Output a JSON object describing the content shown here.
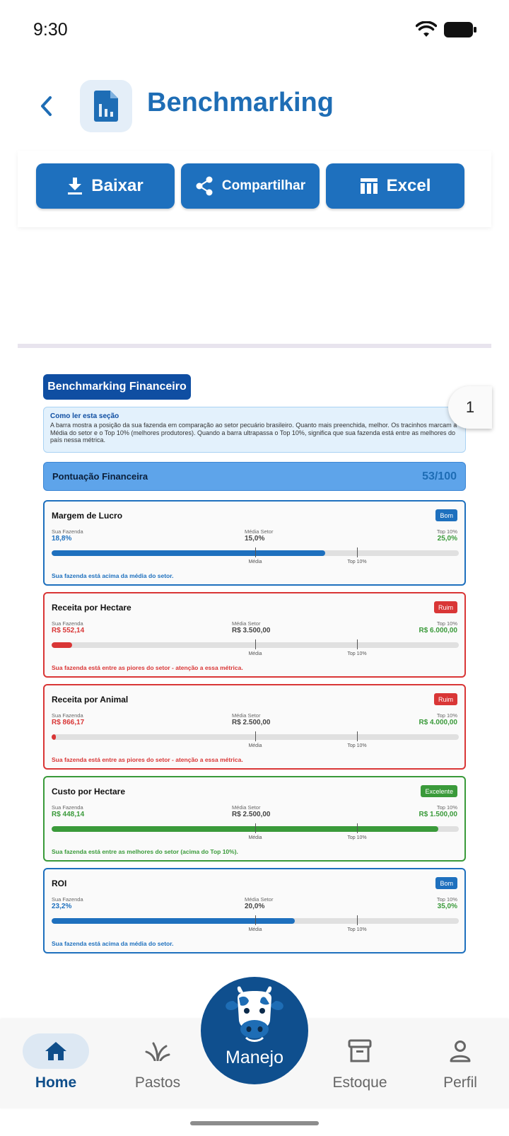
{
  "status_bar": {
    "time": "9:30"
  },
  "header": {
    "title": "Benchmarking"
  },
  "toolbar": {
    "download_label": "Baixar",
    "share_label": "Compartilhar",
    "excel_label": "Excel"
  },
  "page_indicator": "1",
  "section": {
    "title": "Benchmarking Financeiro",
    "info_title": "Como ler esta seção",
    "info_text": "A barra mostra a posição da sua fazenda em comparação ao setor pecuário brasileiro. Quanto mais preenchida, melhor. Os tracinhos marcam a Média do setor e o Top 10% (melhores produtores). Quando a barra ultrapassa o Top 10%, significa que sua fazenda está entre as melhores do país nessa métrica.",
    "score_label": "Pontuação Financeira",
    "score_value": "53/100"
  },
  "labels": {
    "farm": "Sua Fazenda",
    "sector_avg": "Média Setor",
    "top10": "Top 10%",
    "avg_tick": "Média",
    "top_tick": "Top 10%"
  },
  "metrics": [
    {
      "name": "Margem de Lucro",
      "badge": "Bom",
      "farm": "18,8%",
      "avg": "15,0%",
      "top": "25,0%",
      "fill_fraction": 0.672,
      "message": "Sua fazenda está acima da média do setor.",
      "color": "#1e70be"
    },
    {
      "name": "Receita por Hectare",
      "badge": "Ruim",
      "farm": "R$ 552,14",
      "avg": "R$ 3.500,00",
      "top": "R$ 6.000,00",
      "fill_fraction": 0.05,
      "message": "Sua fazenda está entre as piores do setor - atenção a essa métrica.",
      "color": "#d93636"
    },
    {
      "name": "Receita por Animal",
      "badge": "Ruim",
      "farm": "R$ 866,17",
      "avg": "R$ 2.500,00",
      "top": "R$ 4.000,00",
      "fill_fraction": 0.01,
      "message": "Sua fazenda está entre as piores do setor - atenção a essa métrica.",
      "color": "#d93636"
    },
    {
      "name": "Custo por Hectare",
      "badge": "Excelente",
      "farm": "R$ 448,14",
      "avg": "R$ 2.500,00",
      "top": "R$ 1.500,00",
      "fill_fraction": 0.95,
      "message": "Sua fazenda está entre as melhores do setor (acima do Top 10%).",
      "color": "#3a9a3a"
    },
    {
      "name": "ROI",
      "badge": "Bom",
      "farm": "23,2%",
      "avg": "20,0%",
      "top": "35,0%",
      "fill_fraction": 0.597,
      "message": "Sua fazenda está acima da média do setor.",
      "color": "#1e70be"
    }
  ],
  "nav": {
    "home": "Home",
    "pastos": "Pastos",
    "manejo": "Manejo",
    "estoque": "Estoque",
    "perfil": "Perfil",
    "active_color": "#0f4e8a",
    "active_pill": "#dde8f3"
  }
}
